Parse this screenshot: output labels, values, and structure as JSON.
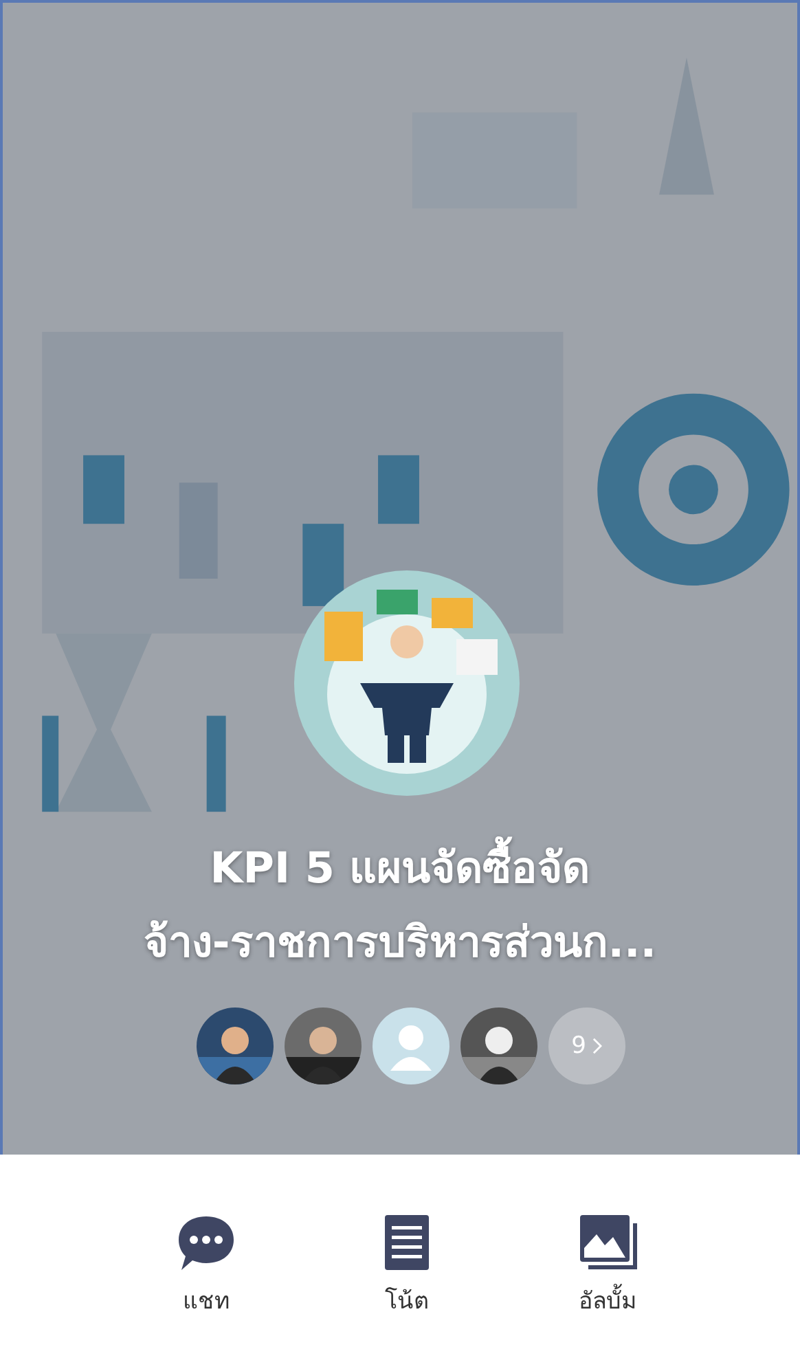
{
  "group": {
    "cover": {
      "kind": "picture"
    },
    "avatar": {
      "kind": "picture"
    },
    "name_lines": [
      "KPI 5 แผนจัดซื้อจัด",
      "จ้าง-ราชการบริหารส่วนก..."
    ],
    "members": [
      {
        "kind": "picture"
      },
      {
        "kind": "picture"
      },
      {
        "kind": "default"
      },
      {
        "kind": "picture"
      }
    ],
    "more_count": "9"
  },
  "actions": [
    {
      "kind": "chat",
      "label": "แชท"
    },
    {
      "kind": "note",
      "label": "โน้ต"
    },
    {
      "kind": "album",
      "label": "อัลบั้ม"
    }
  ]
}
